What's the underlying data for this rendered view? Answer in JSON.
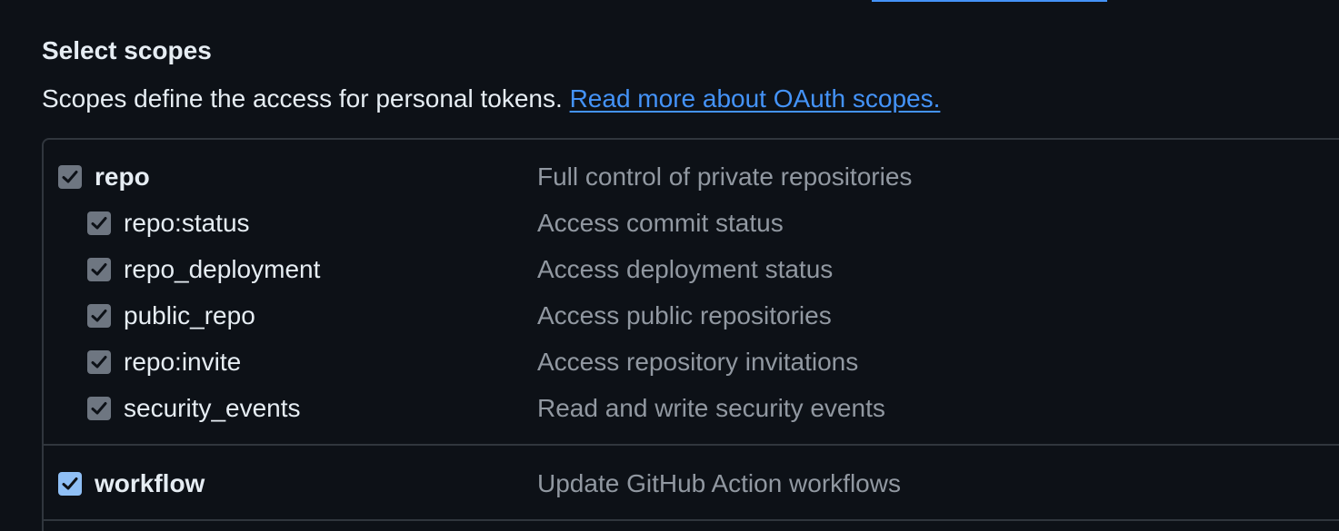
{
  "section": {
    "heading": "Select scopes",
    "intro_text": "Scopes define the access for personal tokens.",
    "intro_link": "Read more about OAuth scopes."
  },
  "scopes": [
    {
      "name": "repo",
      "description": "Full control of private repositories",
      "checked": true,
      "disabled": true
    },
    {
      "name": "repo:status",
      "description": "Access commit status",
      "checked": true,
      "disabled": true
    },
    {
      "name": "repo_deployment",
      "description": "Access deployment status",
      "checked": true,
      "disabled": true
    },
    {
      "name": "public_repo",
      "description": "Access public repositories",
      "checked": true,
      "disabled": true
    },
    {
      "name": "repo:invite",
      "description": "Access repository invitations",
      "checked": true,
      "disabled": true
    },
    {
      "name": "security_events",
      "description": "Read and write security events",
      "checked": true,
      "disabled": true
    },
    {
      "name": "workflow",
      "description": "Update GitHub Action workflows",
      "checked": true,
      "disabled": false
    }
  ],
  "colors": {
    "background": "#0d1117",
    "text": "#e6edf3",
    "muted_text": "#9198a1",
    "link": "#4493f8",
    "border": "#30363d",
    "checkbox_disabled": "#6e7681",
    "checkbox_active": "#8fbff5"
  }
}
